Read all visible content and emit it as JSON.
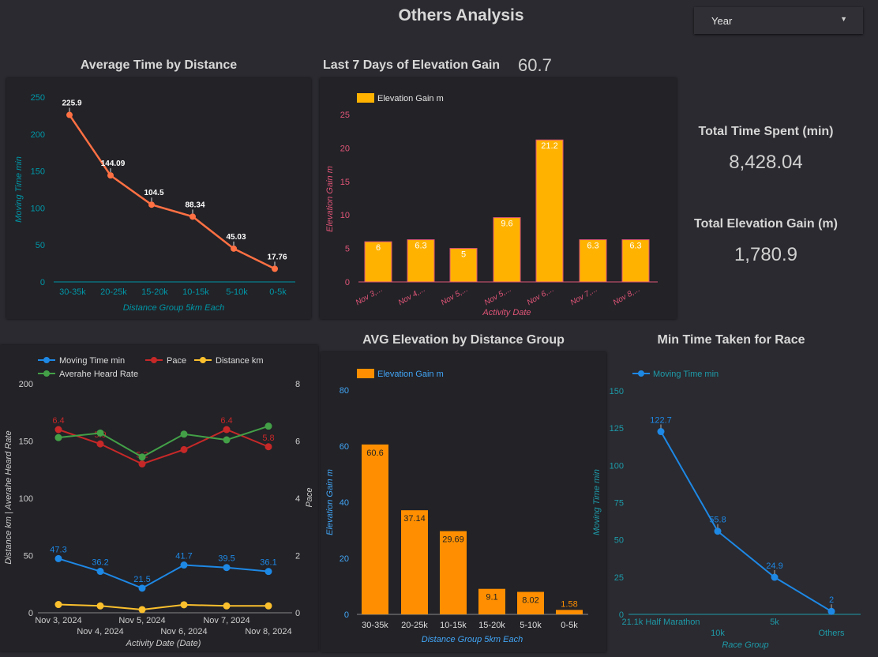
{
  "page_title": "Others Analysis",
  "filter": {
    "selected": "Year",
    "icon": "caret-down-icon"
  },
  "kpis": {
    "last7_value": "60.7",
    "total_time_label": "Total Time Spent (min)",
    "total_time_value": "8,428.04",
    "total_elev_label": "Total Elevation Gain (m)",
    "total_elev_value": "1,780.9"
  },
  "colors": {
    "background": "#2a2a30",
    "card": "#222227",
    "line_orange": "#ff7043",
    "bar_yellow": "#ffb300",
    "bar_orange": "#ff8f00",
    "blue": "#1e88e5",
    "red": "#c62828",
    "green": "#43a047",
    "gold": "#fbc02d",
    "teal": "#0097a7"
  },
  "chart_data": [
    {
      "id": "avg_time",
      "type": "line",
      "title": "Average Time by Distance",
      "xlabel": "Distance Group 5km Each",
      "ylabel": "Moving Time min",
      "categories": [
        "30-35k",
        "20-25k",
        "15-20k",
        "10-15k",
        "5-10k",
        "0-5k"
      ],
      "values": [
        225.9,
        144.09,
        104.5,
        88.34,
        45.03,
        17.76
      ],
      "value_labels": [
        "225.9",
        "144.09",
        "104.5",
        "88.34",
        "45.03",
        "17.76"
      ],
      "ylim": [
        0,
        250
      ],
      "yticks": [
        "0",
        "50",
        "100",
        "150",
        "200",
        "250"
      ]
    },
    {
      "id": "last7",
      "type": "bar",
      "title": "Last 7 Days of Elevation Gain",
      "legend": "Elevation Gain m",
      "xlabel": "Activity Date",
      "ylabel": "Elevation Gain m",
      "categories": [
        "Nov 3,...",
        "Nov 4,...",
        "Nov 5,...",
        "Nov 5,...",
        "Nov 6,...",
        "Nov 7,...",
        "Nov 8,..."
      ],
      "values": [
        6,
        6.3,
        5,
        9.6,
        21.2,
        6.3,
        6.3
      ],
      "value_labels": [
        "6",
        "6.3",
        "5",
        "9.6",
        "21.2",
        "6.3",
        "6.3"
      ],
      "ylim": [
        0,
        25
      ],
      "yticks": [
        "0",
        "5",
        "10",
        "15",
        "20",
        "25"
      ]
    },
    {
      "id": "daily",
      "type": "line",
      "xlabel": "Activity Date (Date)",
      "ylabel": "Distance km | Averahe Heard Rate",
      "y2label": "Pace",
      "legend_placement": "top-left",
      "categories_row1": [
        "Nov 3, 2024",
        "Nov 5, 2024",
        "Nov 7, 2024"
      ],
      "categories_row2": [
        "Nov 4, 2024",
        "Nov 6, 2024",
        "Nov 8, 2024"
      ],
      "ylim": [
        0,
        200
      ],
      "y2lim": [
        0,
        8
      ],
      "yticks": [
        "0",
        "50",
        "100",
        "150",
        "200"
      ],
      "y2ticks": [
        "0",
        "2",
        "4",
        "6",
        "8"
      ],
      "series": [
        {
          "name": "Moving Time min",
          "color": "#1e88e5",
          "axis": "left",
          "values": [
            47.3,
            36.2,
            21.5,
            41.7,
            39.5,
            36.1
          ],
          "labels": [
            "47.3",
            "36.2",
            "21.5",
            "41.7",
            "39.5",
            "36.1"
          ]
        },
        {
          "name": "Pace",
          "color": "#c62828",
          "axis": "right",
          "values": [
            6.4,
            5.9,
            5.2,
            5.7,
            6.4,
            5.8
          ],
          "labels": [
            "6.4",
            "5.9",
            "5.2",
            "",
            "6.4",
            "5.8"
          ]
        },
        {
          "name": "Distance km",
          "color": "#fbc02d",
          "axis": "left",
          "values": [
            7.2,
            6,
            2.8,
            7,
            6,
            6
          ],
          "labels": [
            "",
            "",
            "",
            "",
            "",
            ""
          ]
        },
        {
          "name": "Averahe Heard Rate",
          "color": "#43a047",
          "axis": "left",
          "values": [
            153,
            157,
            136,
            156,
            151,
            163
          ],
          "labels": [
            "",
            "",
            "",
            "",
            "",
            ""
          ]
        }
      ]
    },
    {
      "id": "avg_elev",
      "type": "bar",
      "title": "AVG Elevation by Distance Group",
      "legend": "Elevation Gain m",
      "xlabel": "Distance Group 5km Each",
      "ylabel": "Elevation Gain m",
      "categories": [
        "30-35k",
        "20-25k",
        "10-15k",
        "15-20k",
        "5-10k",
        "0-5k"
      ],
      "values": [
        60.6,
        37.14,
        29.69,
        9.1,
        8.02,
        1.58
      ],
      "value_labels": [
        "60.6",
        "37.14",
        "29.69",
        "9.1",
        "8.02",
        "1.58"
      ],
      "ylim": [
        0,
        80
      ],
      "yticks": [
        "0",
        "20",
        "40",
        "60",
        "80"
      ]
    },
    {
      "id": "min_race",
      "type": "line",
      "title": "Min Time Taken for Race",
      "legend": "Moving Time min",
      "xlabel": "Race Group",
      "ylabel": "Moving Time min",
      "categories": [
        "21.1k Half Marathon",
        "10k",
        "5k",
        "Others"
      ],
      "values": [
        122.7,
        55.8,
        24.9,
        2
      ],
      "value_labels": [
        "122.7",
        "55.8",
        "24.9",
        "2"
      ],
      "ylim": [
        0,
        150
      ],
      "yticks": [
        "0",
        "25",
        "50",
        "75",
        "100",
        "125",
        "150"
      ]
    }
  ]
}
